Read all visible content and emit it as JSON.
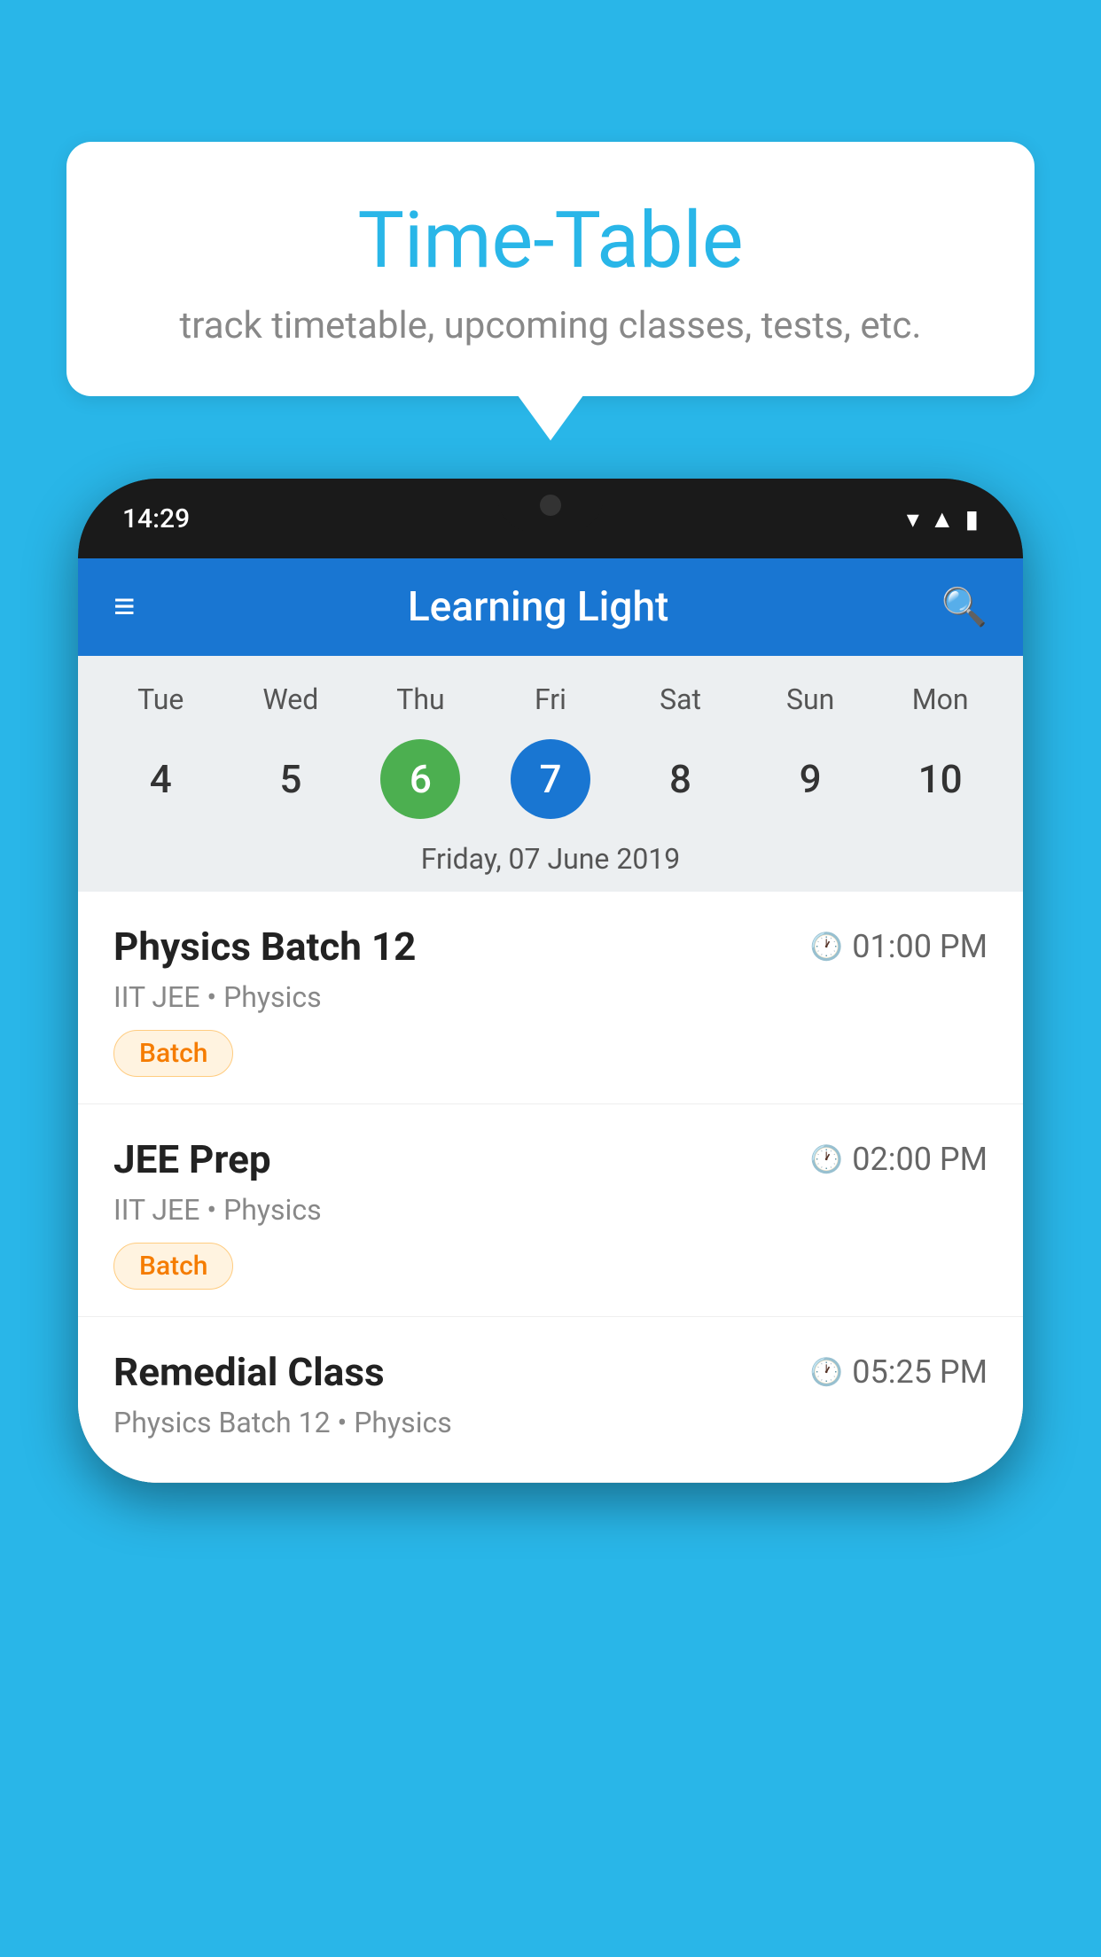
{
  "background_color": "#29B6E8",
  "speech_bubble": {
    "title": "Time-Table",
    "subtitle": "track timetable, upcoming classes, tests, etc."
  },
  "phone": {
    "status_bar": {
      "time": "14:29"
    },
    "app_header": {
      "title": "Learning Light"
    },
    "calendar": {
      "days": [
        "Tue",
        "Wed",
        "Thu",
        "Fri",
        "Sat",
        "Sun",
        "Mon"
      ],
      "dates": [
        "4",
        "5",
        "6",
        "7",
        "8",
        "9",
        "10"
      ],
      "today_index": 2,
      "selected_index": 3,
      "label": "Friday, 07 June 2019"
    },
    "schedule_items": [
      {
        "title": "Physics Batch 12",
        "time": "01:00 PM",
        "subtitle": "IIT JEE • Physics",
        "tag": "Batch"
      },
      {
        "title": "JEE Prep",
        "time": "02:00 PM",
        "subtitle": "IIT JEE • Physics",
        "tag": "Batch"
      },
      {
        "title": "Remedial Class",
        "time": "05:25 PM",
        "subtitle": "Physics Batch 12 • Physics",
        "tag": null
      }
    ]
  }
}
